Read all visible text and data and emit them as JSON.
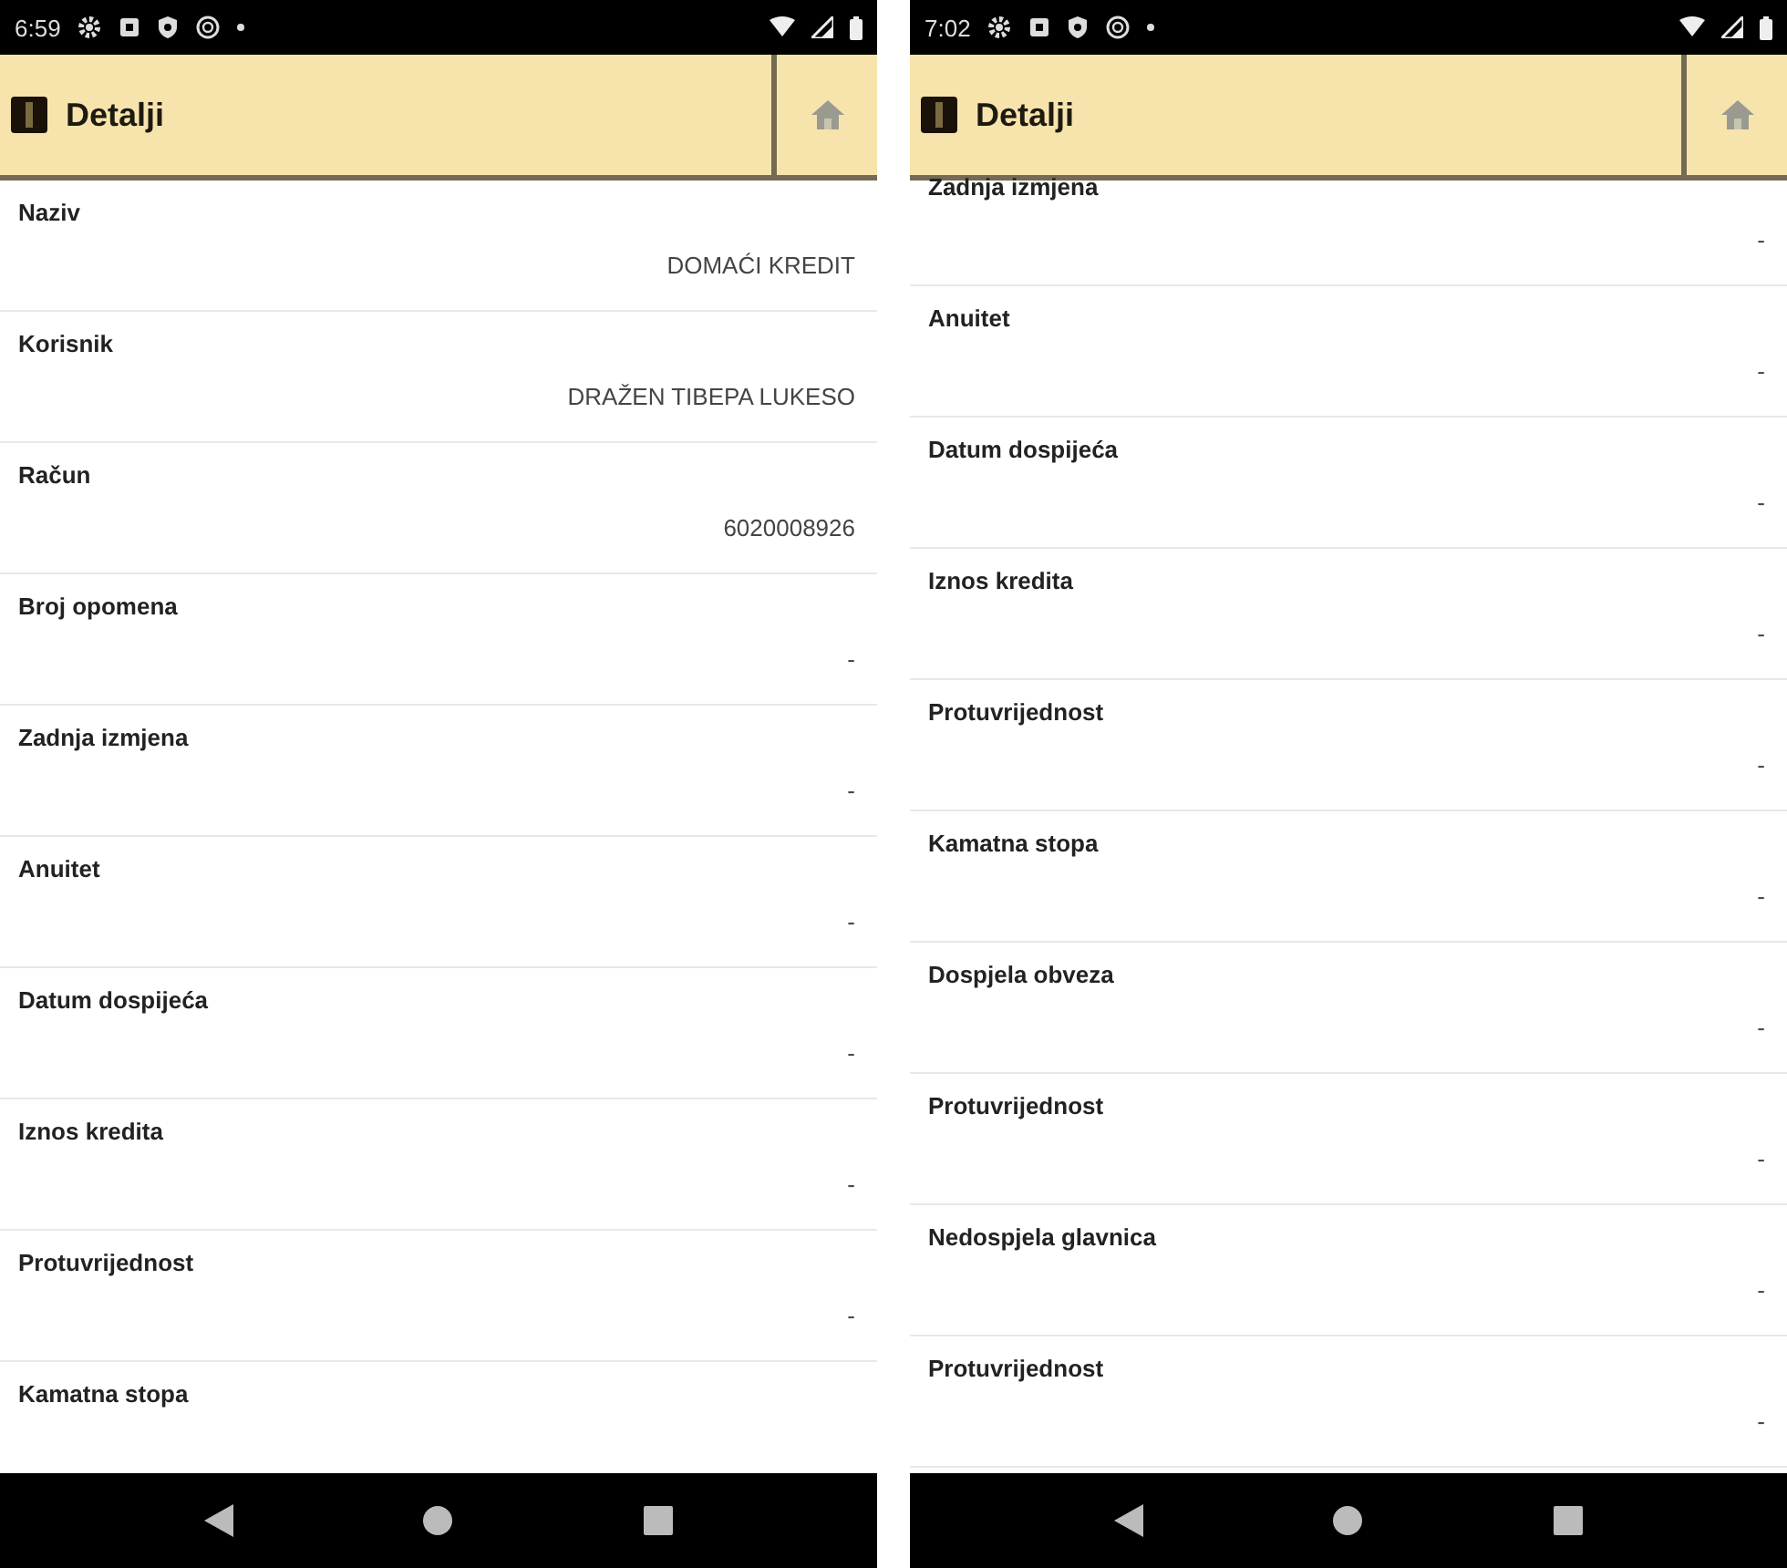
{
  "screens": [
    {
      "status_bar": {
        "time": "6:59"
      },
      "app_bar": {
        "title": "Detalji"
      },
      "fields": [
        {
          "label": "Naziv",
          "value": "DOMAĆI KREDIT"
        },
        {
          "label": "Korisnik",
          "value": "DRAŽEN TIBEPA LUKESO"
        },
        {
          "label": "Račun",
          "value": "6020008926"
        },
        {
          "label": "Broj opomena",
          "value": "-"
        },
        {
          "label": "Zadnja izmjena",
          "value": "-"
        },
        {
          "label": "Anuitet",
          "value": "-"
        },
        {
          "label": "Datum dospijeća",
          "value": "-"
        },
        {
          "label": "Iznos kredita",
          "value": "-"
        },
        {
          "label": "Protuvrijednost",
          "value": "-"
        },
        {
          "label": "Kamatna stopa"
        }
      ]
    },
    {
      "status_bar": {
        "time": "7:02"
      },
      "app_bar": {
        "title": "Detalji"
      },
      "fields": [
        {
          "label": "Zadnja izmjena",
          "value": "-"
        },
        {
          "label": "Anuitet",
          "value": "-"
        },
        {
          "label": "Datum dospijeća",
          "value": "-"
        },
        {
          "label": "Iznos kredita",
          "value": "-"
        },
        {
          "label": "Protuvrijednost",
          "value": "-"
        },
        {
          "label": "Kamatna stopa",
          "value": "-"
        },
        {
          "label": "Dospjela obveza",
          "value": "-"
        },
        {
          "label": "Protuvrijednost",
          "value": "-"
        },
        {
          "label": "Nedospjela glavnica",
          "value": "-"
        },
        {
          "label": "Protuvrijednost",
          "value": "-"
        }
      ]
    }
  ]
}
